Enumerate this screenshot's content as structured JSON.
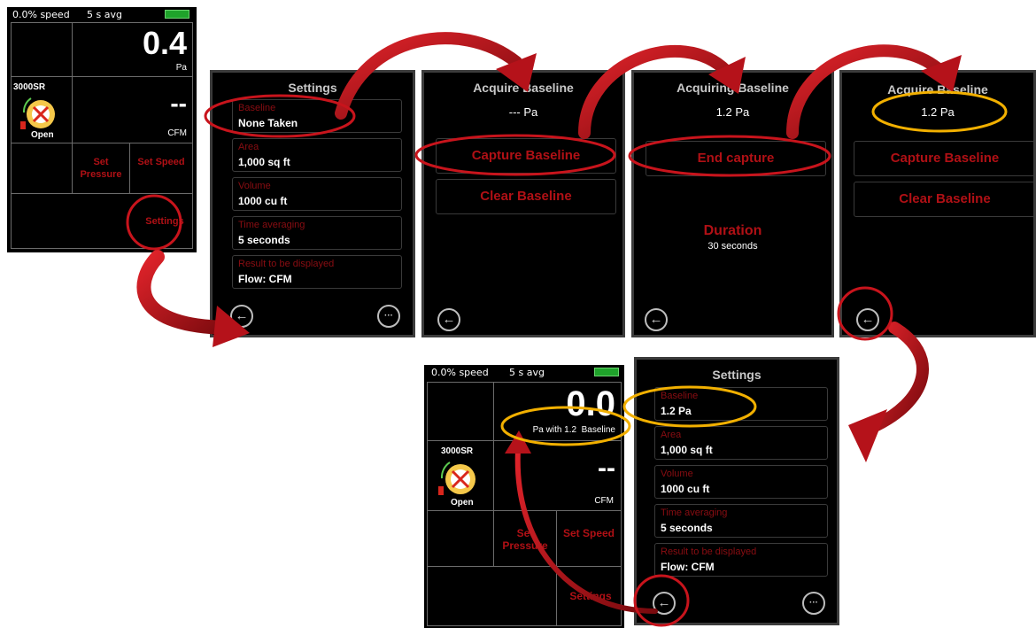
{
  "colors": {
    "annotation_red": "#c8141c",
    "annotation_gold": "#f2b000",
    "button_red": "#b01015",
    "battery_green": "#1fa32b",
    "screen_bg": "#000000"
  },
  "main_screen_1": {
    "speed": "0.0% speed",
    "avg": "5 s avg",
    "pressure_value": "0.4",
    "pressure_unit": "Pa",
    "device_name": "3000SR",
    "damper_state": "Open",
    "flow_value": "--",
    "flow_unit": "CFM",
    "set_pressure": "Set Pressure",
    "set_speed": "Set Speed",
    "settings": "Settings",
    "device_icon": "fan-ring-icon"
  },
  "settings_1": {
    "title": "Settings",
    "items": [
      {
        "label": "Baseline",
        "value": "None Taken"
      },
      {
        "label": "Area",
        "value": "1,000 sq ft"
      },
      {
        "label": "Volume",
        "value": "1000 cu ft"
      },
      {
        "label": "Time averaging",
        "value": "5 seconds"
      },
      {
        "label": "Result to be displayed",
        "value": "Flow: CFM"
      }
    ],
    "back_icon": "back-arrow-icon",
    "more_icon": "more-ellipsis-icon"
  },
  "acquire_1": {
    "title": "Acquire Baseline",
    "value": "--- Pa",
    "capture": "Capture Baseline",
    "clear": "Clear Baseline"
  },
  "acquiring": {
    "title": "Acquiring Baseline",
    "value": "1.2 Pa",
    "end": "End capture",
    "duration_label": "Duration",
    "duration_value": "30 seconds"
  },
  "acquire_2": {
    "title": "Acquire Baseline",
    "value": "1.2 Pa",
    "capture": "Capture Baseline",
    "clear": "Clear Baseline"
  },
  "main_screen_2": {
    "speed": "0.0% speed",
    "avg": "5 s avg",
    "pressure_value": "0.0",
    "pressure_unit": "Pa with 1.2  Baseline",
    "device_name": "3000SR",
    "damper_state": "Open",
    "flow_value": "--",
    "flow_unit": "CFM",
    "set_pressure": "Set Pressure",
    "set_speed": "Set Speed",
    "settings": "Settings"
  },
  "settings_2": {
    "title": "Settings",
    "items": [
      {
        "label": "Baseline",
        "value": "1.2 Pa"
      },
      {
        "label": "Area",
        "value": "1,000 sq ft"
      },
      {
        "label": "Volume",
        "value": "1000 cu ft"
      },
      {
        "label": "Time averaging",
        "value": "5 seconds"
      },
      {
        "label": "Result to be displayed",
        "value": "Flow: CFM"
      }
    ]
  }
}
